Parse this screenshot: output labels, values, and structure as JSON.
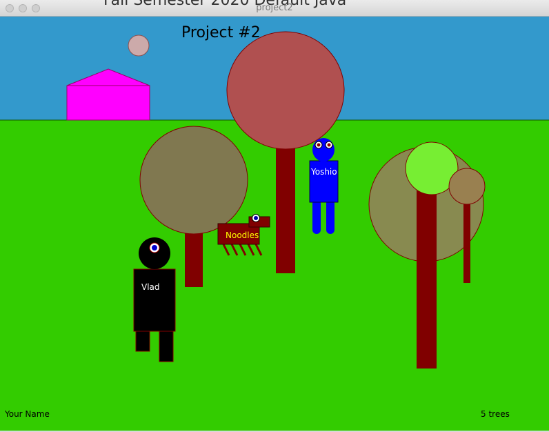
{
  "window": {
    "title": "project2",
    "ghost_title": "Fall Semester 2020 Default Java"
  },
  "scene": {
    "title": "Project #2",
    "author_label": "Your Name",
    "tree_count_label": "5 trees",
    "characters": [
      {
        "name": "Vlad",
        "kind": "person",
        "color": "#000000"
      },
      {
        "name": "Yoshio",
        "kind": "person",
        "color": "#0000ff"
      },
      {
        "name": "Noodles",
        "kind": "dog",
        "color": "#800000"
      }
    ],
    "colors": {
      "sky": "#3399cc",
      "grass": "#33cc00",
      "trunk": "#800000",
      "house": "#ff00ff",
      "sun": "#ccaaaa"
    }
  }
}
